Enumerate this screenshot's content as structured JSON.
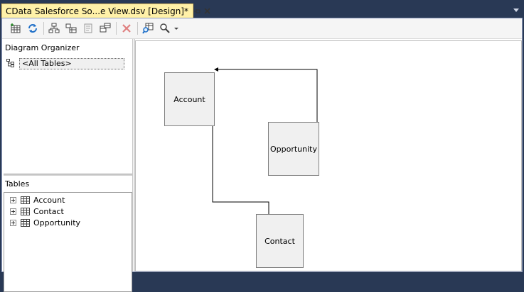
{
  "tab": {
    "title": "CData Salesforce So...e View.dsv [Design]*"
  },
  "toolbar": {
    "buttons": [
      "add-table",
      "refresh",
      "arrange-tables",
      "auto-layout",
      "new-named-query",
      "replace-table",
      "delete",
      "find-table",
      "zoom"
    ]
  },
  "organizer": {
    "title": "Diagram Organizer",
    "all_tables": "<All Tables>"
  },
  "tables": {
    "title": "Tables",
    "items": [
      "Account",
      "Contact",
      "Opportunity"
    ]
  },
  "diagram": {
    "nodes": [
      "Account",
      "Opportunity",
      "Contact"
    ],
    "relationships": [
      {
        "from": "Opportunity",
        "to": "Account"
      },
      {
        "from": "Contact",
        "to": "Account"
      }
    ]
  },
  "colors": {
    "chrome": "#293955",
    "active_tab": "#fff1a8",
    "node_fill": "#f0f0f0"
  }
}
